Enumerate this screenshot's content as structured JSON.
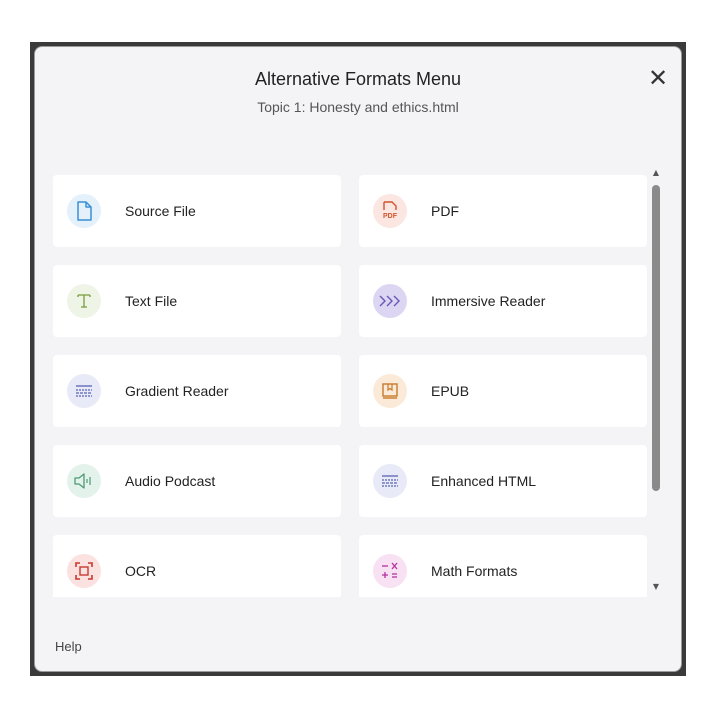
{
  "modal": {
    "title": "Alternative Formats Menu",
    "subtitle": "Topic 1: Honesty and ethics.html",
    "close_label": "✕"
  },
  "formats": [
    {
      "label": "Source File",
      "icon": "document-icon",
      "icon_bg": "#e4f1fb",
      "icon_color": "#3b8fd6"
    },
    {
      "label": "PDF",
      "icon": "pdf-icon",
      "icon_bg": "#fbe6e1",
      "icon_color": "#d2542c",
      "icon_text": "PDF"
    },
    {
      "label": "Text File",
      "icon": "text-icon",
      "icon_bg": "#eef4e6",
      "icon_color": "#7a9b3c"
    },
    {
      "label": "Immersive Reader",
      "icon": "chevrons-icon",
      "icon_bg": "#ddd6f3",
      "icon_color": "#6b56b8"
    },
    {
      "label": "Gradient Reader",
      "icon": "lines-icon",
      "icon_bg": "#e8eaf7",
      "icon_color": "#5a63b4"
    },
    {
      "label": "EPUB",
      "icon": "book-icon",
      "icon_bg": "#fbead8",
      "icon_color": "#c77a2a"
    },
    {
      "label": "Audio Podcast",
      "icon": "speaker-icon",
      "icon_bg": "#e3f3ec",
      "icon_color": "#4d9a74"
    },
    {
      "label": "Enhanced HTML",
      "icon": "lines-icon",
      "icon_bg": "#e8eaf7",
      "icon_color": "#5a63b4"
    },
    {
      "label": "OCR",
      "icon": "scan-icon",
      "icon_bg": "#fbe1df",
      "icon_color": "#c73a2e"
    },
    {
      "label": "Math Formats",
      "icon": "math-icon",
      "icon_bg": "#f7e1f3",
      "icon_color": "#b431a0"
    }
  ],
  "scrollbar": {
    "up": "▲",
    "down": "▼"
  },
  "footer": {
    "help": "Help"
  }
}
